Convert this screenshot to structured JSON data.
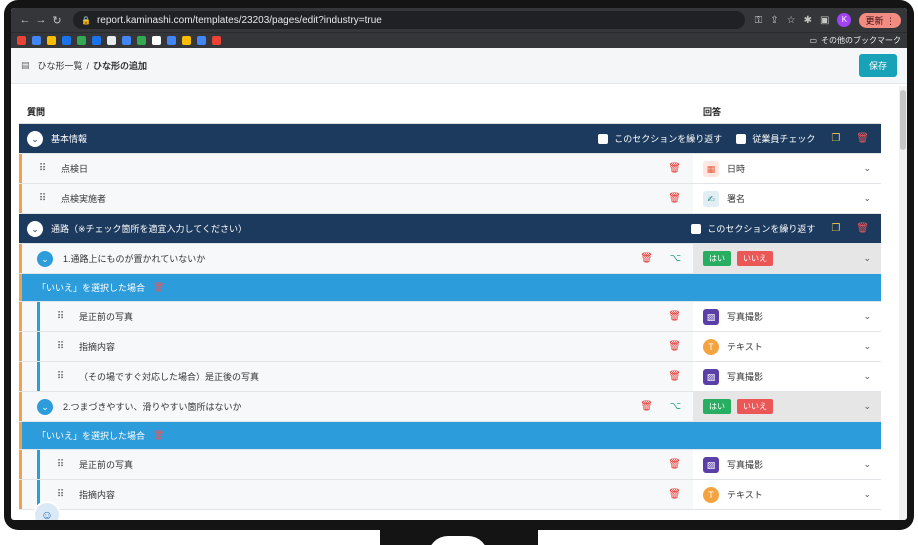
{
  "browser": {
    "url": "report.kaminashi.com/templates/23203/pages/edit?industry=true",
    "update_label": "更新",
    "avatar_letter": "K",
    "bookmarks_folder": "その他のブックマーク",
    "bookmark_colors": [
      "#ea4335",
      "#4285f4",
      "#fbbc04",
      "#1a73e8",
      "#34a853",
      "#1a73e8",
      "#e8eaed",
      "#4285f4",
      "#34a853",
      "#ffffff",
      "#4285f4",
      "#fbbc04",
      "#4285f4",
      "#ea4335"
    ]
  },
  "header": {
    "breadcrumb_parent": "ひな形一覧",
    "separator": "/",
    "breadcrumb_current": "ひな形の追加",
    "save_label": "保存"
  },
  "columns": {
    "question": "質問",
    "answer": "回答"
  },
  "sections": [
    {
      "title": "基本情報",
      "repeat_label": "このセクションを繰り返す",
      "employee_check_label": "従業員チェック",
      "items": [
        {
          "label": "点検日",
          "answer": "日時",
          "icon": "calendar-icon"
        },
        {
          "label": "点検実施者",
          "answer": "署名",
          "icon": "signature-icon"
        }
      ]
    },
    {
      "title": "通路（※チェック箇所を適宜入力してください）",
      "repeat_label": "このセクションを繰り返す",
      "questions": [
        {
          "label": "1.通路上にものが置かれていないか",
          "yes": "はい",
          "no": "いいえ",
          "condition": "「いいえ」を選択した場合",
          "sub_items": [
            {
              "label": "是正前の写真",
              "answer": "写真撮影",
              "icon": "photo-icon"
            },
            {
              "label": "指摘内容",
              "answer": "テキスト",
              "icon": "text-icon"
            },
            {
              "label": "（その場ですぐ対応した場合）是正後の写真",
              "answer": "写真撮影",
              "icon": "photo-icon"
            }
          ]
        },
        {
          "label": "2.つまづきやすい、滑りやすい箇所はないか",
          "yes": "はい",
          "no": "いいえ",
          "condition": "「いいえ」を選択した場合",
          "sub_items": [
            {
              "label": "是正前の写真",
              "answer": "写真撮影",
              "icon": "photo-icon"
            },
            {
              "label": "指摘内容",
              "answer": "テキスト",
              "icon": "text-icon"
            }
          ]
        }
      ]
    }
  ]
}
